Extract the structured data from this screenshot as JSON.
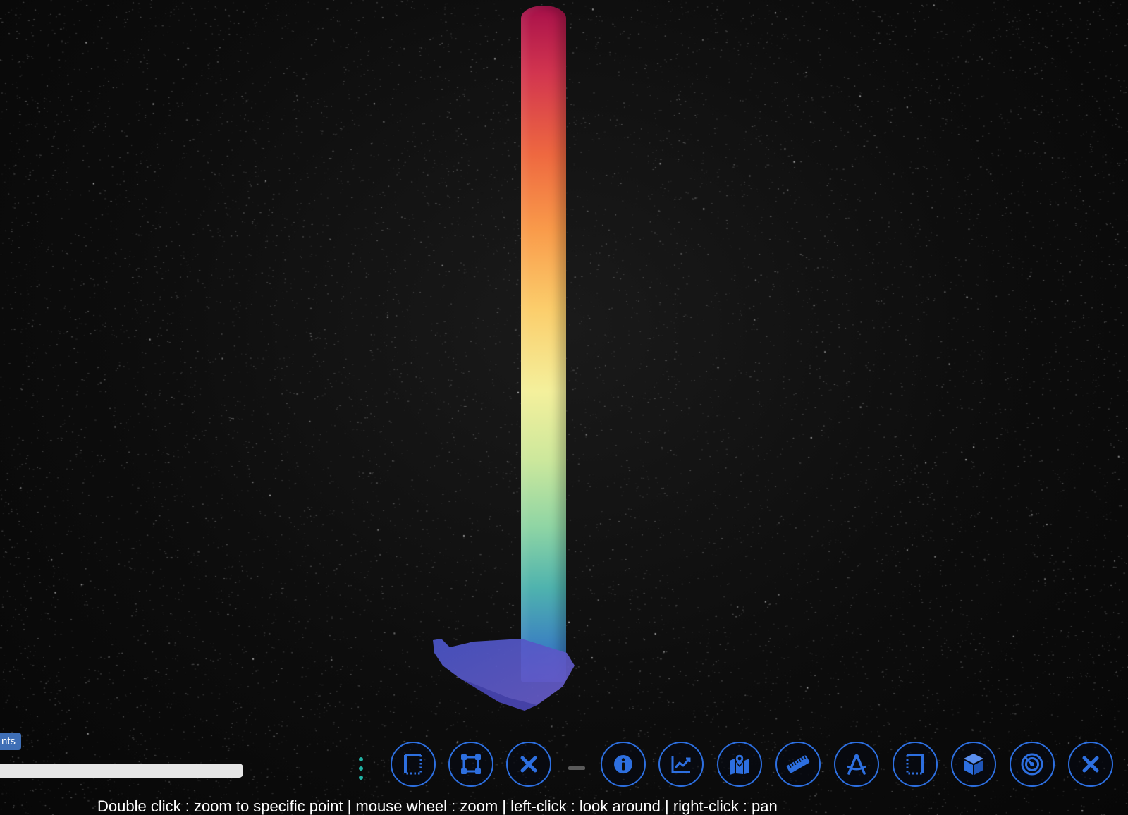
{
  "left_panel": {
    "badge_text": "nts"
  },
  "toolbar": {
    "accent_color": "#2d6fe0",
    "grip_color": "#21b3a5",
    "buttons": [
      {
        "name": "select-area-icon",
        "label": "select area"
      },
      {
        "name": "select-box-icon",
        "label": "select box"
      },
      {
        "name": "clear-selection-icon",
        "label": "clear selection"
      },
      {
        "name": "info-icon",
        "label": "info"
      },
      {
        "name": "profile-chart-icon",
        "label": "profile"
      },
      {
        "name": "map-pin-icon",
        "label": "location"
      },
      {
        "name": "ruler-icon",
        "label": "measure"
      },
      {
        "name": "compass-drafting-icon",
        "label": "angle"
      },
      {
        "name": "clip-area-icon",
        "label": "clip"
      },
      {
        "name": "cube-icon",
        "label": "volume"
      },
      {
        "name": "radius-icon",
        "label": "circle"
      },
      {
        "name": "close-all-icon",
        "label": "remove all"
      }
    ]
  },
  "help": {
    "text": "Double click : zoom to specific point | mouse wheel : zoom | left-click : look around | right-click : pan"
  }
}
